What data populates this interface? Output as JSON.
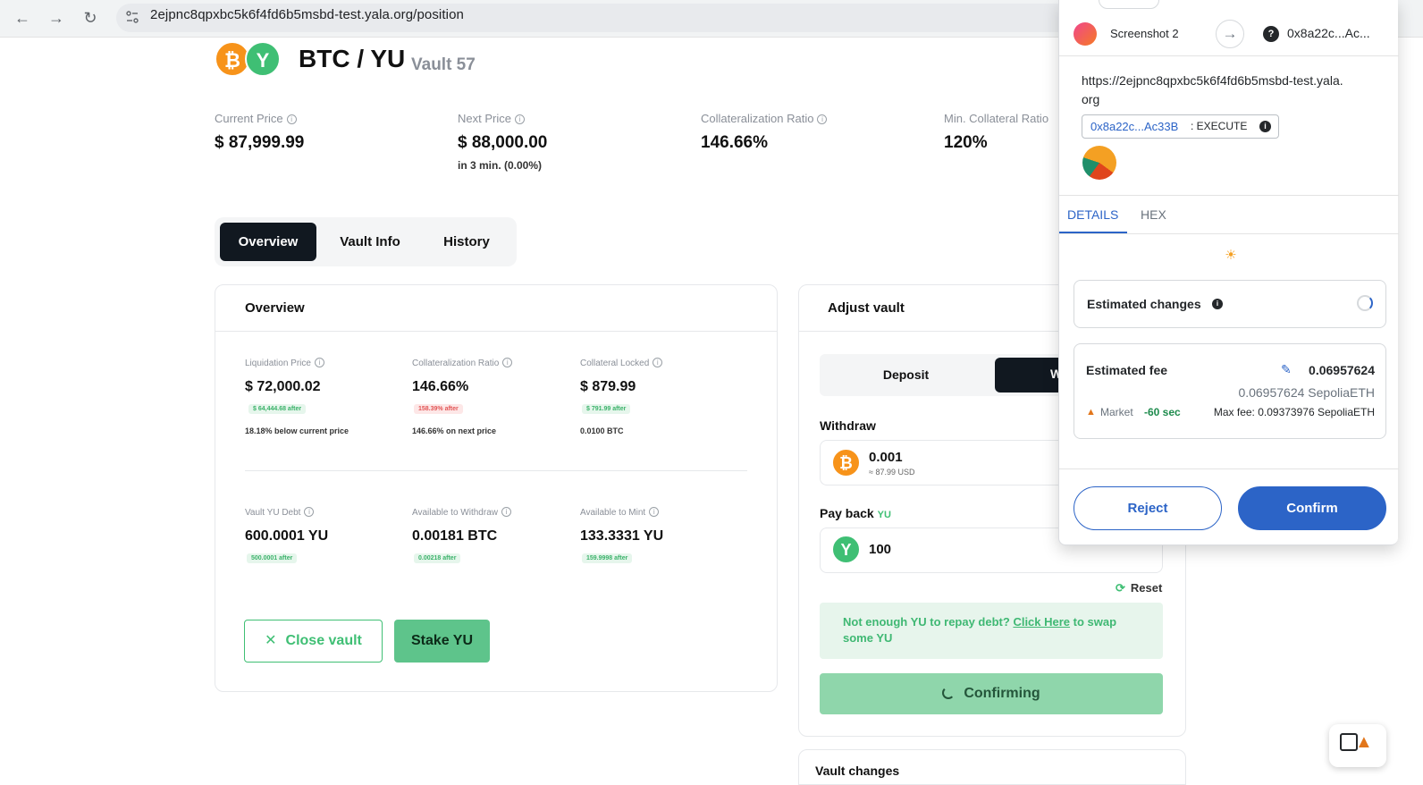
{
  "browser": {
    "url": "2ejpnc8qpxbc5k6f4fd6b5msbd-test.yala.org/position"
  },
  "header": {
    "pair": "BTC / YU",
    "vault": "Vault 57"
  },
  "stats": [
    {
      "label": "Current Price",
      "value": "$ 87,999.99",
      "sub": ""
    },
    {
      "label": "Next Price",
      "value": "$ 88,000.00",
      "sub": "in 3 min. (0.00%)"
    },
    {
      "label": "Collateralization Ratio",
      "value": "146.66%",
      "sub": ""
    },
    {
      "label": "Min. Collateral Ratio",
      "value": "120%",
      "sub": ""
    }
  ],
  "tabs": [
    "Overview",
    "Vault Info",
    "History"
  ],
  "overview": {
    "title": "Overview",
    "items": [
      {
        "label": "Liquidation Price",
        "value": "$ 72,000.02",
        "badge": "$ 64,444.68 after",
        "badge_color": "green",
        "note": "18.18% below current price"
      },
      {
        "label": "Collateralization Ratio",
        "value": "146.66%",
        "badge": "158.39% after",
        "badge_color": "red",
        "note": "146.66% on next price"
      },
      {
        "label": "Collateral Locked",
        "value": "$ 879.99",
        "badge": "$ 791.99 after",
        "badge_color": "green",
        "note": "0.0100 BTC"
      },
      {
        "label": "Vault YU Debt",
        "value": "600.0001 YU",
        "badge": "500.0001 after",
        "badge_color": "green",
        "note": ""
      },
      {
        "label": "Available to Withdraw",
        "value": "0.00181 BTC",
        "badge": "0.00218 after",
        "badge_color": "green",
        "note": ""
      },
      {
        "label": "Available to Mint",
        "value": "133.3331 YU",
        "badge": "159.9998 after",
        "badge_color": "green",
        "note": ""
      }
    ],
    "close_vault": "Close vault",
    "stake": "Stake YU"
  },
  "adjust": {
    "title": "Adjust vault",
    "deposit": "Deposit",
    "withdraw_tab_partial": "W",
    "withdraw_label": "Withdraw",
    "withdraw_amount": "0.001",
    "withdraw_usd": "≈ 87.99 USD",
    "payback_label": "Pay back",
    "payback_token": "YU",
    "payback_amount": "100",
    "reset": "Reset",
    "warn_prefix": "Not enough YU to repay debt? ",
    "warn_link": "Click Here",
    "warn_suffix": " to swap some YU",
    "confirming": "Confirming",
    "vault_changes": "Vault changes"
  },
  "metamask": {
    "account": "Screenshot 2",
    "to_address": "0x8a22c...Ac...",
    "origin": "https://2ejpnc8qpxbc5k6f4fd6b5msbd-test.yala.org",
    "contract": "0x8a22c...Ac33B",
    "method": ": EXECUTE",
    "tabs": [
      "DETAILS",
      "HEX"
    ],
    "estimated_changes": "Estimated changes",
    "estimated_fee": "Estimated fee",
    "fee_value": "0.06957624",
    "fee_eth": "0.06957624 SepoliaETH",
    "market": "Market",
    "market_time": "-60 sec",
    "max_fee": "Max fee: 0.09373976 SepoliaETH",
    "reject": "Reject",
    "confirm": "Confirm"
  },
  "colors": {
    "accent_green": "#3fbf74",
    "mm_blue": "#2c64c7",
    "btc_orange": "#f7931a"
  }
}
